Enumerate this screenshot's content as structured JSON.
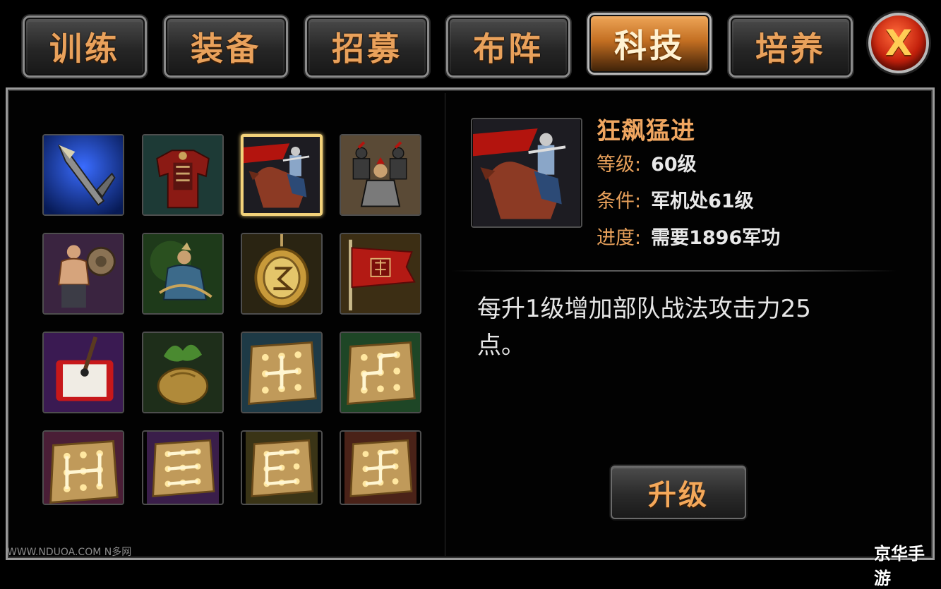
{
  "tabs": [
    {
      "label": "训练",
      "active": false
    },
    {
      "label": "装备",
      "active": false
    },
    {
      "label": "招募",
      "active": false
    },
    {
      "label": "布阵",
      "active": false
    },
    {
      "label": "科技",
      "active": true
    },
    {
      "label": "培养",
      "active": false
    }
  ],
  "close_button": {
    "label": "X"
  },
  "tech_grid": [
    {
      "icon": "spear-icon"
    },
    {
      "icon": "armor-icon"
    },
    {
      "icon": "cavalry-charge-icon",
      "selected": true
    },
    {
      "icon": "soldier-group-icon"
    },
    {
      "icon": "strongman-icon"
    },
    {
      "icon": "archer-general-icon"
    },
    {
      "icon": "gold-token-icon"
    },
    {
      "icon": "war-flag-icon"
    },
    {
      "icon": "scroll-brush-icon"
    },
    {
      "icon": "herb-sack-icon"
    },
    {
      "icon": "formation-board-icon"
    },
    {
      "icon": "formation-board-icon"
    },
    {
      "icon": "formation-board-icon"
    },
    {
      "icon": "formation-board-icon"
    },
    {
      "icon": "formation-board-icon"
    },
    {
      "icon": "formation-board-icon"
    }
  ],
  "detail": {
    "portrait_icon": "cavalry-charge-icon",
    "name": "狂飙猛进",
    "level_label": "等级:",
    "level_value": "60级",
    "condition_label": "条件:",
    "condition_value": "军机处61级",
    "progress_label": "进度:",
    "progress_value": "需要1896军功",
    "description": "每升1级增加部队战法攻击力25点。"
  },
  "upgrade_button": {
    "label": "升级"
  },
  "watermarks": {
    "left": "WWW.NDUOA.COM N多网",
    "right": "京华手游"
  },
  "colors": {
    "accent": "#e9a15b",
    "active_tab": "#c36f22",
    "selected_border": "#f3d27a"
  }
}
